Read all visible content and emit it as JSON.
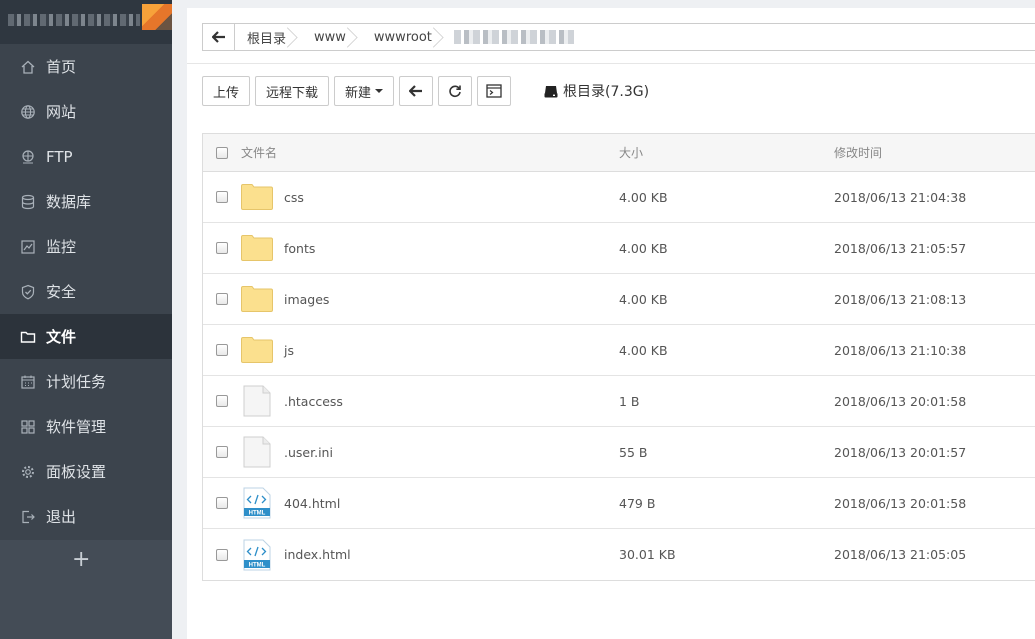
{
  "sidebar": {
    "items": [
      {
        "label": "首页",
        "icon": "home-icon",
        "active": false
      },
      {
        "label": "网站",
        "icon": "globe-icon",
        "active": false
      },
      {
        "label": "FTP",
        "icon": "ftp-icon",
        "active": false
      },
      {
        "label": "数据库",
        "icon": "database-icon",
        "active": false
      },
      {
        "label": "监控",
        "icon": "monitor-icon",
        "active": false
      },
      {
        "label": "安全",
        "icon": "shield-icon",
        "active": false
      },
      {
        "label": "文件",
        "icon": "folder-icon",
        "active": true
      },
      {
        "label": "计划任务",
        "icon": "calendar-icon",
        "active": false
      },
      {
        "label": "软件管理",
        "icon": "apps-icon",
        "active": false
      },
      {
        "label": "面板设置",
        "icon": "gear-icon",
        "active": false
      },
      {
        "label": "退出",
        "icon": "logout-icon",
        "active": false
      }
    ],
    "add_label": "+"
  },
  "path": {
    "crumbs": [
      "根目录",
      "www",
      "wwwroot"
    ]
  },
  "toolbar": {
    "upload": "上传",
    "remote_download": "远程下载",
    "new": "新建",
    "disk_label": "根目录(7.3G)"
  },
  "table": {
    "headers": {
      "name": "文件名",
      "size": "大小",
      "mtime": "修改时间"
    },
    "rows": [
      {
        "name": "css",
        "type": "folder",
        "size": "4.00 KB",
        "mtime": "2018/06/13 21:04:38"
      },
      {
        "name": "fonts",
        "type": "folder",
        "size": "4.00 KB",
        "mtime": "2018/06/13 21:05:57"
      },
      {
        "name": "images",
        "type": "folder",
        "size": "4.00 KB",
        "mtime": "2018/06/13 21:08:13"
      },
      {
        "name": "js",
        "type": "folder",
        "size": "4.00 KB",
        "mtime": "2018/06/13 21:10:38"
      },
      {
        "name": ".htaccess",
        "type": "file",
        "size": "1 B",
        "mtime": "2018/06/13 20:01:58"
      },
      {
        "name": ".user.ini",
        "type": "file",
        "size": "55 B",
        "mtime": "2018/06/13 20:01:57"
      },
      {
        "name": "404.html",
        "type": "html",
        "size": "479 B",
        "mtime": "2018/06/13 20:01:58"
      },
      {
        "name": "index.html",
        "type": "html",
        "size": "30.01 KB",
        "mtime": "2018/06/13 21:05:05"
      }
    ]
  },
  "colors": {
    "sidebar_bg": "#3c444d",
    "sidebar_active": "#2c333b",
    "folder": "#fbe08e",
    "html_badge": "#2e8fc9"
  }
}
